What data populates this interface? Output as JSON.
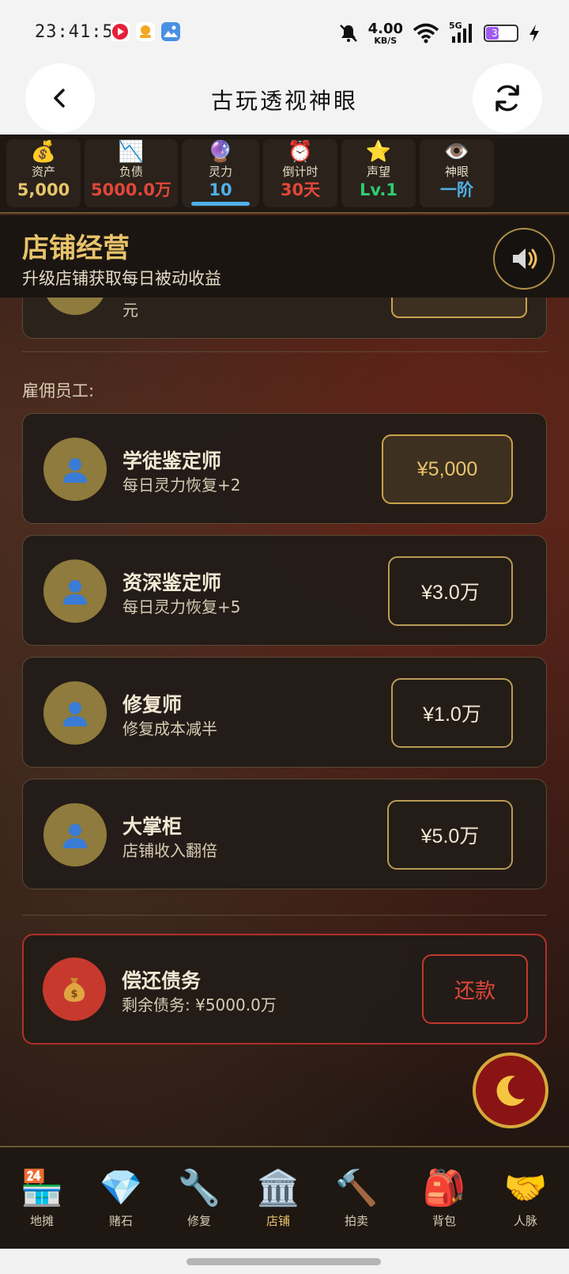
{
  "status_bar": {
    "time": "23:41:58",
    "net_speed_value": "4.00",
    "net_speed_unit": "KB/S",
    "signal_label": "5G",
    "battery": "30"
  },
  "title_bar": {
    "title": "古玩透视神眼"
  },
  "stats": [
    {
      "icon": "💰",
      "label": "资产",
      "value": "5,000",
      "color": "#e8c46a"
    },
    {
      "icon": "📉",
      "label": "负债",
      "value": "5000.0万",
      "color": "#e0473a"
    },
    {
      "icon": "🔮",
      "label": "灵力",
      "value": "10",
      "color": "#4fb0e8"
    },
    {
      "icon": "⏰",
      "label": "倒计时",
      "value": "30天",
      "color": "#e0473a"
    },
    {
      "icon": "⭐",
      "label": "声望",
      "value": "Lv.1",
      "color": "#2ecc71"
    },
    {
      "icon": "👁️",
      "label": "神眼",
      "value": "一阶",
      "color": "#4fb0e8"
    }
  ],
  "section": {
    "title": "店铺经营",
    "subtitle": "升级店铺获取每日被动收益",
    "partial_card_text": "元"
  },
  "staff": {
    "group_label": "雇佣员工:",
    "items": [
      {
        "name": "学徒鉴定师",
        "desc": "每日灵力恢复+2",
        "price": "¥5,000"
      },
      {
        "name": "资深鉴定师",
        "desc": "每日灵力恢复+5",
        "price": "¥3.0万"
      },
      {
        "name": "修复师",
        "desc": "修复成本减半",
        "price": "¥1.0万"
      },
      {
        "name": "大掌柜",
        "desc": "店铺收入翻倍",
        "price": "¥5.0万"
      }
    ]
  },
  "debt": {
    "title": "偿还债务",
    "remaining": "剩余债务: ¥5000.0万",
    "button": "还款"
  },
  "bottom_nav": [
    {
      "icon": "🏪",
      "label": "地摊"
    },
    {
      "icon": "💎",
      "label": "赌石"
    },
    {
      "icon": "🔧",
      "label": "修复"
    },
    {
      "icon": "🏛️",
      "label": "店铺"
    },
    {
      "icon": "🔨",
      "label": "拍卖"
    },
    {
      "icon": "🎒",
      "label": "背包"
    },
    {
      "icon": "🤝",
      "label": "人脉"
    }
  ],
  "colors": {
    "accent_gold": "#e8c46a",
    "debt_red": "#e0473a",
    "spirit_blue": "#4fb0e8",
    "reputation_green": "#2ecc71"
  }
}
